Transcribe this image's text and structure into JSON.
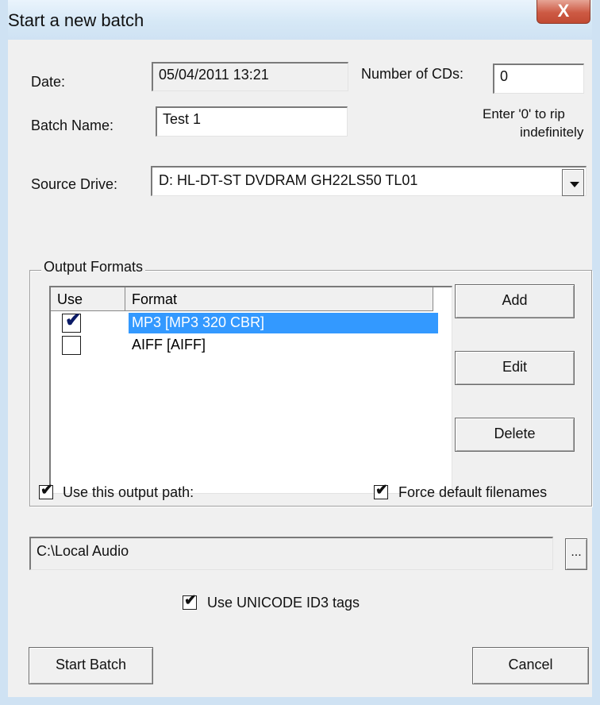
{
  "window": {
    "title": "Start a new batch",
    "close_label": "X"
  },
  "date": {
    "label": "Date:",
    "value": "05/04/2011 13:21"
  },
  "batch_name": {
    "label": "Batch Name:",
    "value": "Test 1"
  },
  "num_cds": {
    "label": "Number of CDs:",
    "value": "0",
    "hint_line1": "Enter '0' to rip",
    "hint_line2": "indefinitely"
  },
  "source_drive": {
    "label": "Source Drive:",
    "value": "D: HL-DT-ST DVDRAM GH22LS50  TL01"
  },
  "output_formats": {
    "legend": "Output Formats",
    "col_use": "Use",
    "col_format": "Format",
    "rows": [
      {
        "format": "MP3 [MP3 320 CBR]",
        "checked": true,
        "selected": true
      },
      {
        "format": "AIFF [AIFF]",
        "checked": false,
        "selected": false
      }
    ],
    "add_label": "Add",
    "edit_label": "Edit",
    "delete_label": "Delete"
  },
  "options": {
    "use_output_path": {
      "label": "Use this output path:",
      "checked": true
    },
    "force_default_filenames": {
      "label": "Force default filenames",
      "checked": true
    },
    "output_path": "C:\\Local Audio",
    "browse_label": "...",
    "unicode_id3": {
      "label": "Use UNICODE ID3 tags",
      "checked": true
    }
  },
  "buttons": {
    "start_label": "Start Batch",
    "cancel_label": "Cancel"
  }
}
